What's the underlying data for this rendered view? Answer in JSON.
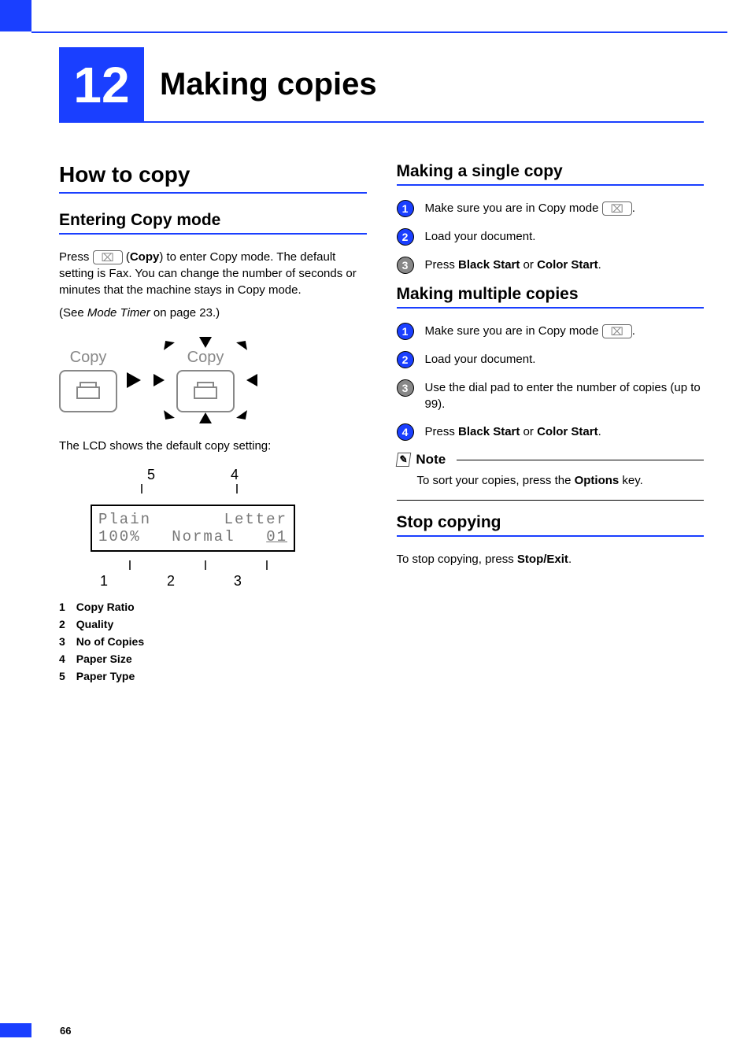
{
  "page_number": "66",
  "chapter": {
    "number": "12",
    "title": "Making copies"
  },
  "left": {
    "h1": "How to copy",
    "h2": "Entering Copy mode",
    "p1_a": "Press ",
    "p1_btn": "⌧",
    "p1_b": " (",
    "p1_copy": "Copy",
    "p1_c": ") to enter Copy mode. The default setting is Fax. You can change the number of seconds or minutes that the machine stays in Copy mode.",
    "p2_a": "(See ",
    "p2_link": "Mode Timer",
    "p2_b": " on page 23.)",
    "diagram_caption_left": "Copy",
    "diagram_caption_right": "Copy",
    "lcd_intro": "The LCD shows the default copy setting:",
    "lcd": {
      "top_labels": [
        "5",
        "4"
      ],
      "row1_left": "Plain",
      "row1_right": "Letter",
      "row2_left": "100%",
      "row2_mid": "Normal",
      "row2_right": "01",
      "bottom_labels": [
        "1",
        "2",
        "3"
      ]
    },
    "legend": [
      {
        "n": "1",
        "t": "Copy Ratio"
      },
      {
        "n": "2",
        "t": "Quality"
      },
      {
        "n": "3",
        "t": "No of Copies"
      },
      {
        "n": "4",
        "t": "Paper Size"
      },
      {
        "n": "5",
        "t": "Paper Type"
      }
    ]
  },
  "right": {
    "h2a": "Making a single copy",
    "single_steps": [
      {
        "type": "blue",
        "n": "1",
        "t_a": "Make sure you are in Copy mode ",
        "btn": "⌧",
        "t_b": "."
      },
      {
        "type": "blue",
        "n": "2",
        "t_a": "Load your document.",
        "btn": "",
        "t_b": ""
      },
      {
        "type": "gray",
        "n": "3",
        "t_a": "Press ",
        "bold1": "Black Start",
        "mid": " or ",
        "bold2": "Color Start",
        "t_b": "."
      }
    ],
    "h2b": "Making multiple copies",
    "multi_steps": [
      {
        "type": "blue",
        "n": "1",
        "t_a": "Make sure you are in Copy mode ",
        "btn": "⌧",
        "t_b": "."
      },
      {
        "type": "blue",
        "n": "2",
        "t_a": "Load your document.",
        "btn": "",
        "t_b": ""
      },
      {
        "type": "gray",
        "n": "3",
        "t_a": "Use the dial pad to enter the number of copies (up to 99).",
        "btn": "",
        "t_b": ""
      },
      {
        "type": "blue",
        "n": "4",
        "t_a": "Press ",
        "bold1": "Black Start",
        "mid": " or ",
        "bold2": "Color Start",
        "t_b": "."
      }
    ],
    "note_label": "Note",
    "note_a": "To sort your copies, press the ",
    "note_bold": "Options",
    "note_b": " key.",
    "h2c": "Stop copying",
    "stop_a": "To stop copying, press ",
    "stop_bold": "Stop/Exit",
    "stop_b": "."
  }
}
